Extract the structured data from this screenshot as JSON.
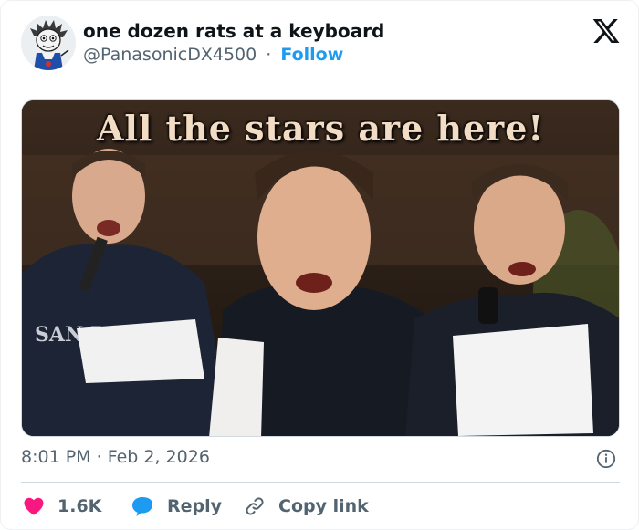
{
  "author": {
    "display_name": "one dozen rats at a keyboard",
    "handle": "@PanasonicDX4500",
    "separator": "·",
    "follow_label": "Follow",
    "avatar": "cartoon-avatar"
  },
  "platform": {
    "logo": "x-logo-icon"
  },
  "media": {
    "caption": "All the stars are here!",
    "shirt_text": "SAN DIEGO",
    "description_icon": "photo"
  },
  "meta": {
    "time": "8:01 PM",
    "separator": "·",
    "date": "Feb 2, 2026",
    "info_icon": "info-icon"
  },
  "actions": {
    "like_count": "1.6K",
    "reply_label": "Reply",
    "copy_label": "Copy link"
  },
  "colors": {
    "accent": "#1d9bf0",
    "like": "#f91880",
    "text": "#0f1419",
    "secondary": "#536471"
  }
}
